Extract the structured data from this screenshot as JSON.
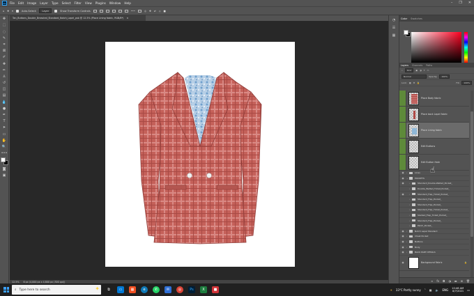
{
  "menubar": {
    "app_icon": "Ps",
    "items": [
      "File",
      "Edit",
      "Image",
      "Layer",
      "Type",
      "Select",
      "Filter",
      "View",
      "Plugins",
      "Window",
      "Help"
    ]
  },
  "options": {
    "auto_select_label": "Auto-Select:",
    "auto_select_value": "Layer",
    "transform_label": "Show Transform Controls"
  },
  "document": {
    "tab_title": "Tan_Buttons_Double_Breasted_Standard_Notch_Lapel_psb @ 12.5% (Place Lining fabric, RGB/8*)",
    "tab_close": "×"
  },
  "status": {
    "zoom": "12.5%",
    "info": "6 px (4,000 px x 4,800 px (300 ppi))"
  },
  "color_panel": {
    "tabs": [
      "Color",
      "Swatches"
    ]
  },
  "layers_panel": {
    "tabs": [
      "Layers",
      "Channels",
      "Paths"
    ],
    "kind_label": "Kind",
    "blend_mode": "Normal",
    "opacity_label": "Opacity:",
    "opacity_value": "100%",
    "lock_label": "Lock:",
    "fill_label": "Fill:",
    "fill_value": "100%",
    "thumb_layers": [
      {
        "name": "Place Body fabric"
      },
      {
        "name": "Place back Lapel fabric"
      },
      {
        "name": "Place Lining fabric"
      },
      {
        "name": "Edit Buttons"
      },
      {
        "name": "Edit Button Hole"
      }
    ],
    "rows": [
      {
        "name": "Lines"
      },
      {
        "name": "POCKETS"
      },
      {
        "name": "Standard_Double-Welted_Pocket_"
      },
      {
        "name": "Double_Welted_Ticket_Pocket_"
      },
      {
        "name": "Standard_Flap_Ticket_Pocket_"
      },
      {
        "name": "Standard_Flap_Pocket_"
      },
      {
        "name": "Standard_Flap_Pocket_"
      },
      {
        "name": "Standard_Flap_Ticket_Pocket_"
      },
      {
        "name": "Slanted_Flap_Ticket_Pocket_"
      },
      {
        "name": "Standard_Flap_Pocket_"
      },
      {
        "name": "Patch_Pocket_"
      },
      {
        "name": "Notch Lapel Standard"
      },
      {
        "name": "Chest Pocket"
      },
      {
        "name": "Buttons"
      },
      {
        "name": "Body"
      },
      {
        "name": "BACK PART DETAILS"
      }
    ],
    "background_layer": "Background Fabric"
  },
  "taskbar": {
    "search_placeholder": "Type here to search",
    "weather": "33°C  Partly sunny",
    "time": "10:46 AM",
    "date": "8/7/2021"
  },
  "colors": {
    "fabric": "#c5615a",
    "fabric_dark": "#a84a45",
    "lining": "#8fb4d6",
    "layer_green": "#5e8a3a"
  }
}
